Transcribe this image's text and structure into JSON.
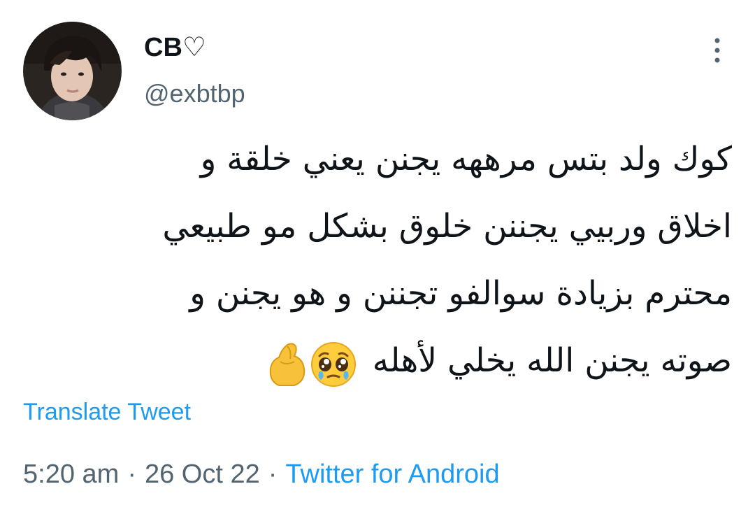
{
  "tweet": {
    "author": {
      "display_name": "CB♡",
      "handle": "@exbtbp"
    },
    "text_lines": [
      "كوك ولد بتس مرههه يجنن يعني خلقة و",
      "اخلاق وربيي يجننن خلوق بشكل مو طبيعي",
      "محترم بزيادة سوالفو تجننن و هو يجنن و",
      "صوته يجنن الله يخلي لأهله"
    ],
    "emojis": [
      "pleading-face",
      "pinched-fingers"
    ],
    "translate_label": "Translate Tweet",
    "time": "5:20 am",
    "date": "26 Oct 22",
    "separator": "·",
    "source": "Twitter for Android"
  },
  "colors": {
    "text": "#0f1419",
    "secondary": "#536471",
    "link": "#1d9bf0"
  }
}
